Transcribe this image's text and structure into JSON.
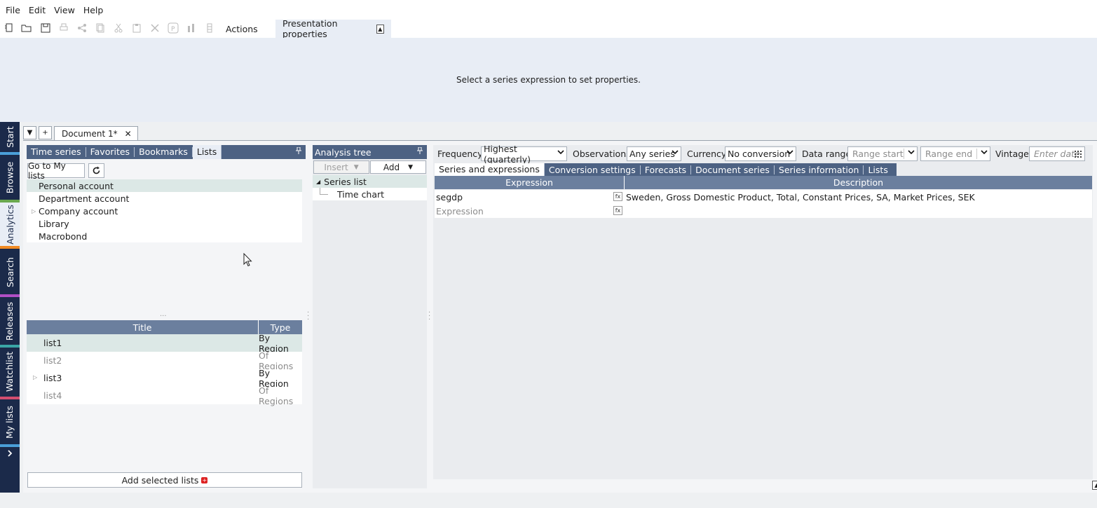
{
  "menu": [
    "File",
    "Edit",
    "View",
    "Help"
  ],
  "toolbar": {
    "actions_label": "Actions",
    "presentation_label": "Presentation properties"
  },
  "properties": {
    "message": "Select a series expression to set properties."
  },
  "leftbar": [
    "Start",
    "Browse",
    "Analytics",
    "Search",
    "Releases",
    "Watchlist",
    "My lists"
  ],
  "document": {
    "tab_label": "Document 1*"
  },
  "browser": {
    "tabs": [
      "Time series",
      "Favorites",
      "Bookmarks",
      "Lists"
    ],
    "go_button": "Go to My lists",
    "accounts": [
      "Personal account",
      "Department account",
      "Company account",
      "Library",
      "Macrobond"
    ],
    "table_headers": [
      "Title",
      "Type"
    ],
    "rows": [
      {
        "title": "list1",
        "type": "By Region"
      },
      {
        "title": "list2",
        "type": "Of Regions"
      },
      {
        "title": "list3",
        "type": "By Region"
      },
      {
        "title": "list4",
        "type": "Of Regions"
      }
    ],
    "add_button": "Add selected lists"
  },
  "analysis_tree": {
    "title": "Analysis tree",
    "insert_label": "Insert",
    "add_label": "Add",
    "items": [
      "Series list",
      "Time chart"
    ]
  },
  "series_options": {
    "frequency_label": "Frequency",
    "frequency_value": "Highest (quarterly)",
    "observations_label": "Observations",
    "observations_value": "Any series",
    "currency_label": "Currency",
    "currency_value": "No conversion",
    "data_range_label": "Data range",
    "range_start_placeholder": "Range start",
    "range_end_placeholder": "Range end",
    "vintage_label": "Vintage",
    "vintage_placeholder": "Enter date"
  },
  "series_tabs": [
    "Series and expressions",
    "Conversion settings",
    "Forecasts",
    "Document series",
    "Series information",
    "Lists"
  ],
  "expressions": {
    "headers": [
      "Expression",
      "Description"
    ],
    "rows": [
      {
        "expression": "segdp",
        "description": "Sweden, Gross Domestic Product, Total, Constant Prices, SA, Market Prices, SEK"
      }
    ],
    "new_placeholder": "Expression",
    "fx_label": "fx"
  },
  "colors": {
    "nav_dark": "#1b2a4a",
    "header_blue": "#4d6283",
    "table_header": "#6b7f9e",
    "selection": "#dce8e6",
    "props_bg": "#e8edf5"
  }
}
